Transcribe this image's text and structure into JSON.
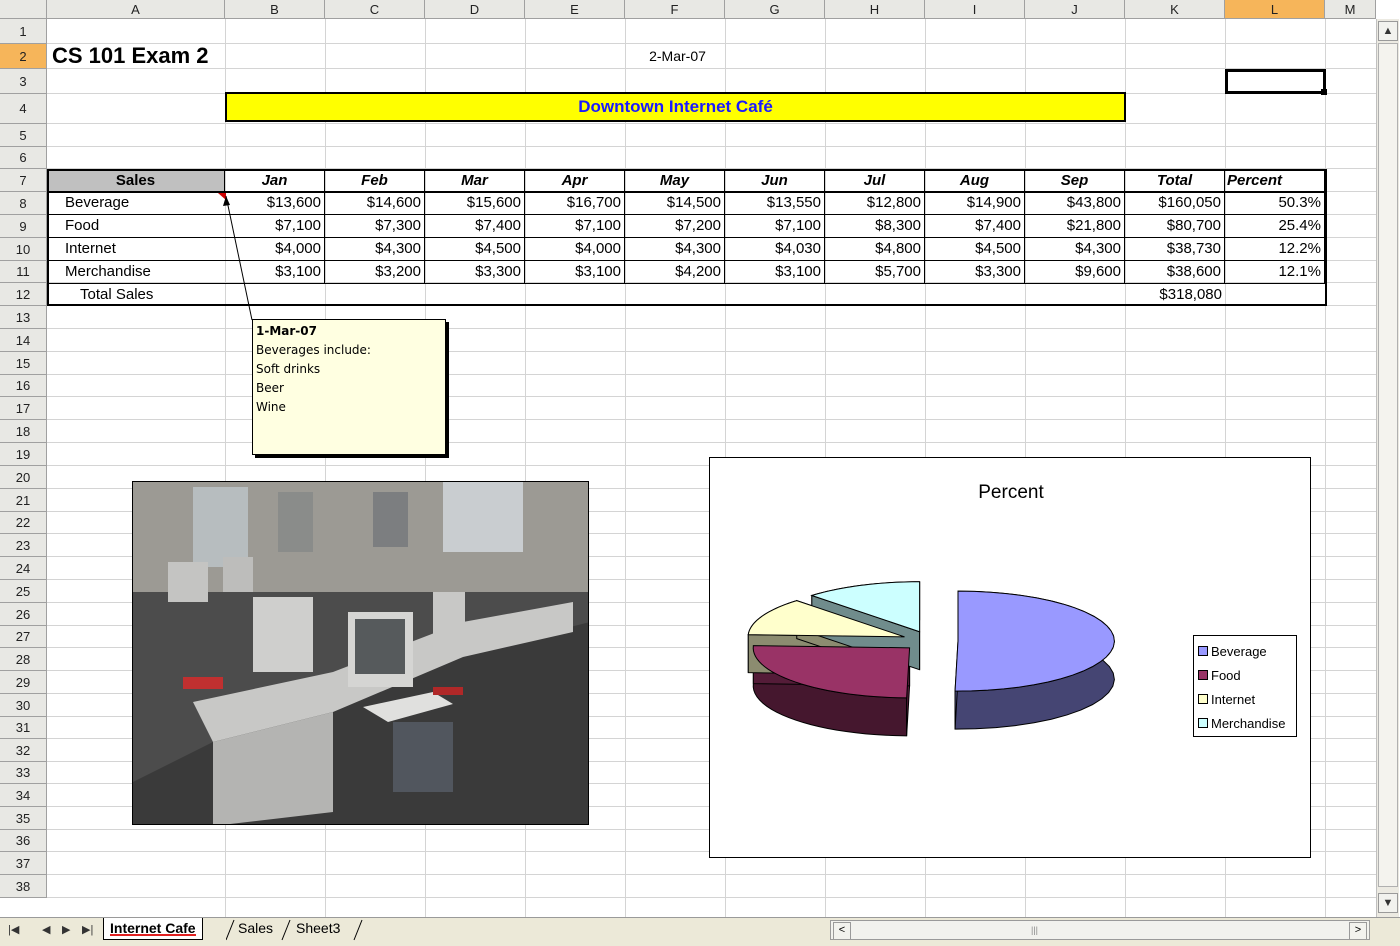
{
  "columns": [
    "A",
    "B",
    "C",
    "D",
    "E",
    "F",
    "G",
    "H",
    "I",
    "J",
    "K",
    "L",
    "M"
  ],
  "rows": [
    "1",
    "2",
    "3",
    "4",
    "5",
    "6",
    "7",
    "8",
    "9",
    "10",
    "11",
    "12",
    "13",
    "14",
    "15",
    "16",
    "17",
    "18",
    "19",
    "20",
    "21",
    "22",
    "23",
    "24",
    "25",
    "26",
    "27",
    "28",
    "29",
    "30",
    "31",
    "32",
    "33",
    "34",
    "35",
    "36",
    "37",
    "38"
  ],
  "selected_cell": {
    "column": "L",
    "row": "2"
  },
  "title": "CS 101 Exam 2",
  "date": "2-Mar-07",
  "banner": "Downtown Internet Café",
  "table": {
    "headers": [
      "Sales",
      "Jan",
      "Feb",
      "Mar",
      "Apr",
      "May",
      "Jun",
      "Jul",
      "Aug",
      "Sep",
      "Total",
      "Percent"
    ],
    "rows": [
      {
        "label": "Beverage",
        "values": [
          "$13,600",
          "$14,600",
          "$15,600",
          "$16,700",
          "$14,500",
          "$13,550",
          "$12,800",
          "$14,900",
          "$43,800",
          "$160,050",
          "50.3%"
        ]
      },
      {
        "label": "Food",
        "values": [
          "$7,100",
          "$7,300",
          "$7,400",
          "$7,100",
          "$7,200",
          "$7,100",
          "$8,300",
          "$7,400",
          "$21,800",
          "$80,700",
          "25.4%"
        ]
      },
      {
        "label": "Internet",
        "values": [
          "$4,000",
          "$4,300",
          "$4,500",
          "$4,000",
          "$4,300",
          "$4,030",
          "$4,800",
          "$4,500",
          "$4,300",
          "$38,730",
          "12.2%"
        ]
      },
      {
        "label": "Merchandise",
        "values": [
          "$3,100",
          "$3,200",
          "$3,300",
          "$3,100",
          "$4,200",
          "$3,100",
          "$5,700",
          "$3,300",
          "$9,600",
          "$38,600",
          "12.1%"
        ]
      }
    ],
    "total_label": "Total Sales",
    "total_value": "$318,080"
  },
  "comment": {
    "title": "1-Mar-07",
    "lines": [
      "Beverages include:",
      "Soft drinks",
      "Beer",
      "Wine"
    ]
  },
  "chart_data": {
    "type": "pie",
    "title": "Percent",
    "categories": [
      "Beverage",
      "Food",
      "Internet",
      "Merchandise"
    ],
    "values": [
      50.3,
      25.4,
      12.2,
      12.1
    ],
    "colors": [
      "#9999ff",
      "#993366",
      "#ffffcc",
      "#ccffff"
    ],
    "legend": "right"
  },
  "photo_icon": "computer-lab-photo",
  "tabs": [
    "Internet Cafe",
    "Sales",
    "Sheet3"
  ],
  "active_tab": "Internet Cafe"
}
